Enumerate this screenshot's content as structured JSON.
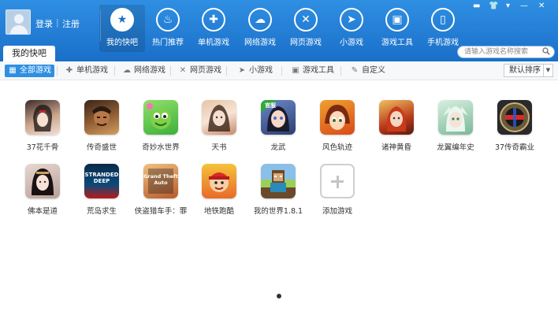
{
  "header": {
    "login": "登录",
    "separator": "|",
    "register": "注册",
    "nav": [
      {
        "label": "我的快吧",
        "icon": "star-icon"
      },
      {
        "label": "热门推荐",
        "icon": "flame-icon"
      },
      {
        "label": "单机游戏",
        "icon": "gamepad-icon"
      },
      {
        "label": "网络游戏",
        "icon": "cloud-icon"
      },
      {
        "label": "网页游戏",
        "icon": "crossed-swords-icon"
      },
      {
        "label": "小游戏",
        "icon": "paper-plane-icon"
      },
      {
        "label": "游戏工具",
        "icon": "toolbox-icon"
      },
      {
        "label": "手机游戏",
        "icon": "phone-icon"
      }
    ],
    "window_controls": [
      "▬",
      "👕",
      "▾",
      "—",
      "✕"
    ]
  },
  "tab": {
    "main": "我的快吧",
    "search_placeholder": "请输入游戏名称搜索"
  },
  "filters": [
    {
      "label": "全部游戏",
      "icon": "grid-icon",
      "active": true
    },
    {
      "label": "单机游戏",
      "icon": "gamepad-icon"
    },
    {
      "label": "网络游戏",
      "icon": "cloud-icon"
    },
    {
      "label": "网页游戏",
      "icon": "crossed-swords-icon"
    },
    {
      "label": "小游戏",
      "icon": "paper-plane-icon"
    },
    {
      "label": "游戏工具",
      "icon": "toolbox-icon"
    },
    {
      "label": "自定义",
      "icon": "pencil-icon"
    }
  ],
  "sort": {
    "selected": "默认排序"
  },
  "games": [
    {
      "name": "37花千骨"
    },
    {
      "name": "传奇盛世"
    },
    {
      "name": "奇妙水世界"
    },
    {
      "name": "天书"
    },
    {
      "name": "龙武",
      "badge": "官服"
    },
    {
      "name": "风色轨迹"
    },
    {
      "name": "诸神黄昏"
    },
    {
      "name": "龙翼编年史"
    },
    {
      "name": "37传奇霸业"
    },
    {
      "name": "佛本是道"
    },
    {
      "name": "荒岛求生",
      "icon_text": "STRANDED DEEP"
    },
    {
      "name": "侠盗猎车手：罪",
      "icon_text": "Grand Theft Auto"
    },
    {
      "name": "地铁跑酷"
    },
    {
      "name": "我的世界1.8.1"
    }
  ],
  "add_game": {
    "label": "添加游戏"
  },
  "colors": {
    "header_blue": "#1a6fc8",
    "accent": "#2f8fe3"
  }
}
